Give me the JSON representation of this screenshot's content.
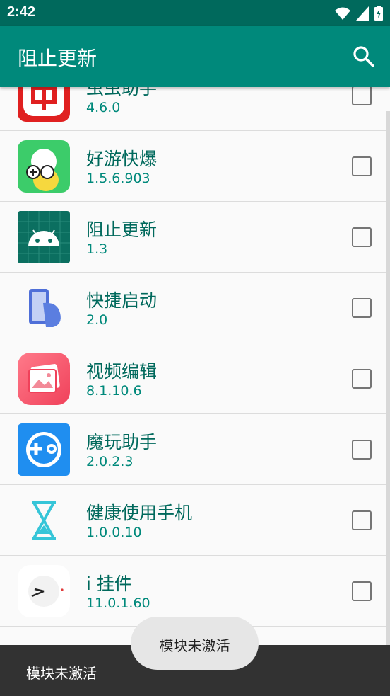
{
  "status_bar": {
    "time": "2:42",
    "icons": [
      "wifi-icon",
      "signal-icon",
      "battery-icon"
    ]
  },
  "app_bar": {
    "title": "阻止更新",
    "action_icon": "search-icon",
    "color": "#00897b"
  },
  "apps": [
    {
      "name": "虫虫助手",
      "version": "4.6.0",
      "icon": "chongchong-icon",
      "checked": false
    },
    {
      "name": "好游快爆",
      "version": "1.5.6.903",
      "icon": "haoyou-icon",
      "checked": false
    },
    {
      "name": "阻止更新",
      "version": "1.3",
      "icon": "android-icon",
      "checked": false
    },
    {
      "name": "快捷启动",
      "version": "2.0",
      "icon": "phone-hand-icon",
      "checked": false
    },
    {
      "name": "视频编辑",
      "version": "8.1.10.6",
      "icon": "photo-icon",
      "checked": false
    },
    {
      "name": "魔玩助手",
      "version": "2.0.2.3",
      "icon": "mowan-icon",
      "checked": false
    },
    {
      "name": "健康使用手机",
      "version": "1.0.0.10",
      "icon": "hourglass-icon",
      "checked": false
    },
    {
      "name": "i 挂件",
      "version": "11.0.1.60",
      "icon": "clock-widget-icon",
      "checked": false
    },
    {
      "name": "",
      "version": "",
      "icon": "partial-icon",
      "checked": false
    }
  ],
  "snackbar": {
    "text": "模块未激活"
  },
  "toast": {
    "text": "模块未激活"
  }
}
